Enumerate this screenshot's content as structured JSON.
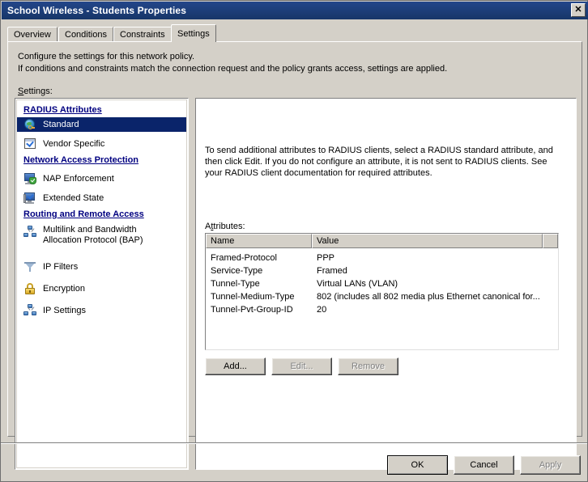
{
  "window": {
    "title": "School Wireless - Students Properties",
    "close_label": "✕",
    "close_icon": "close-icon"
  },
  "tabs": [
    {
      "label": "Overview",
      "active": false
    },
    {
      "label": "Conditions",
      "active": false
    },
    {
      "label": "Constraints",
      "active": false
    },
    {
      "label": "Settings",
      "active": true
    }
  ],
  "page": {
    "intro_line1": "Configure the settings for this network policy.",
    "intro_line2": "If conditions and constraints match the connection request and the policy grants access, settings are applied.",
    "settings_label": "Settings:"
  },
  "tree": {
    "groups": [
      {
        "label": "RADIUS Attributes"
      },
      {
        "label": "Network Access Protection"
      },
      {
        "label": "Routing and Remote Access"
      }
    ],
    "items": [
      {
        "label": "Standard",
        "icon": "globe-key-icon",
        "selected": true
      },
      {
        "label": "Vendor Specific",
        "icon": "window-check-icon",
        "selected": false
      },
      {
        "label": "NAP Enforcement",
        "icon": "monitor-shield-icon",
        "selected": false
      },
      {
        "label": "Extended State",
        "icon": "monitor-check-icon",
        "selected": false
      },
      {
        "label": "Multilink and Bandwidth\nAllocation Protocol (BAP)",
        "icon": "network-nodes-icon",
        "selected": false
      },
      {
        "label": "IP Filters",
        "icon": "funnel-icon",
        "selected": false
      },
      {
        "label": "Encryption",
        "icon": "padlock-icon",
        "selected": false
      },
      {
        "label": "IP Settings",
        "icon": "network-nodes-icon",
        "selected": false
      }
    ]
  },
  "details": {
    "description": "To send additional attributes to RADIUS clients, select a RADIUS standard attribute, and then click Edit. If you do not configure an attribute, it is not sent to RADIUS clients. See your RADIUS client documentation for required attributes.",
    "attributes_label": "Attributes:",
    "columns": [
      "Name",
      "Value",
      ""
    ],
    "rows": [
      {
        "name": "Framed-Protocol",
        "value": "PPP"
      },
      {
        "name": "Service-Type",
        "value": "Framed"
      },
      {
        "name": "Tunnel-Type",
        "value": "Virtual LANs (VLAN)"
      },
      {
        "name": "Tunnel-Medium-Type",
        "value": "802 (includes all 802 media plus Ethernet canonical for..."
      },
      {
        "name": "Tunnel-Pvt-Group-ID",
        "value": "20"
      }
    ],
    "buttons": [
      {
        "label": "Add...",
        "enabled": true
      },
      {
        "label": "Edit...",
        "enabled": false
      },
      {
        "label": "Remove",
        "enabled": false
      }
    ]
  },
  "dialog_buttons": [
    {
      "label": "OK",
      "enabled": true,
      "default": true
    },
    {
      "label": "Cancel",
      "enabled": true,
      "default": false
    },
    {
      "label": "Apply",
      "enabled": false,
      "default": false
    }
  ],
  "colors": {
    "titlebar": "#1b3d78",
    "dialog_bg": "#d4d0c8",
    "selection": "#0a246a",
    "group_heading": "#000080",
    "disabled_text": "#808080"
  }
}
